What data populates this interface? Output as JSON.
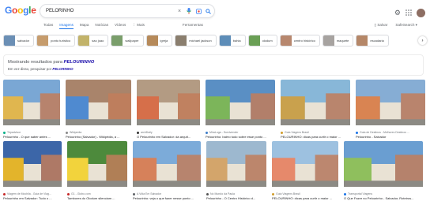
{
  "header": {
    "logo": [
      "G",
      "o",
      "o",
      "g",
      "l",
      "e"
    ],
    "logo_colors": [
      "#4285f4",
      "#ea4335",
      "#fbbc05",
      "#4285f4",
      "#34a853",
      "#ea4335"
    ],
    "query": "PELORINHO"
  },
  "tabs": {
    "items": [
      "Todas",
      "Imagens",
      "Mapa",
      "Notícias",
      "Vídeos",
      "⋮ Mais"
    ],
    "active": "Imagens",
    "tools": "Ferramentas",
    "safe": "Salvar",
    "safesearch": "SafeSearch"
  },
  "chips": [
    {
      "label": "salvador",
      "color": "#6b8fb5"
    },
    {
      "label": "ponto turístico",
      "color": "#c69c6d"
    },
    {
      "label": "sao joao",
      "color": "#c2b36a"
    },
    {
      "label": "wallpaper",
      "color": "#7a9e6b"
    },
    {
      "label": "igreja",
      "color": "#b68a5a"
    },
    {
      "label": "michael jackson",
      "color": "#8a7e6e"
    },
    {
      "label": "bahia",
      "color": "#5d8db8"
    },
    {
      "label": "olodum",
      "color": "#6a9f55"
    },
    {
      "label": "centro histórico",
      "color": "#b7876e"
    },
    {
      "label": "maquete",
      "color": "#a7a3a0"
    },
    {
      "label": "escadaria",
      "color": "#b58768"
    }
  ],
  "results": {
    "showing_prefix": "Mostrando resultados para",
    "showing_term": "PELOURINHO",
    "instead_prefix": "Em vez disso, pesquisar por",
    "instead_term": "PELORINHO"
  },
  "row1": [
    {
      "source": "Tripadvisor",
      "title": "Pelourinho - O que saber antes ...",
      "color": "#7aa7d4",
      "accent": "#e0b64f",
      "dot": "#00af87"
    },
    {
      "source": "Wikipedia",
      "title": "Pelourinho (Salvador) - Wikipédia, a ...",
      "color": "#a9846b",
      "accent": "#4f8ad0",
      "dot": "#888888"
    },
    {
      "source": "archDaily",
      "title": "O Pelourinho em Salvador: da arquit...",
      "color": "#b39b83",
      "accent": "#d66f4a",
      "dot": "#333333"
    },
    {
      "source": "MiraLuga - Survivender",
      "title": "Pelourinho: bairro tudo sobre esse ponto ...",
      "color": "#5a8fc4",
      "accent": "#7cb55a",
      "dot": "#3b7cc9"
    },
    {
      "source": "Guia Viagens Brasil",
      "title": "PELOURINHO: dicas para curtir o maior ...",
      "color": "#88b7d8",
      "accent": "#c9a14d",
      "dot": "#d19d2a"
    },
    {
      "source": "Guia de Destinos - Melhores Destinos ...",
      "title": "Pelourinho - Salvador",
      "color": "#86add4",
      "accent": "#d98452",
      "dot": "#1a73e8"
    }
  ],
  "row2": [
    {
      "source": "Viagem de Mochila - Guia de Viag...",
      "title": "Pelourinho em Salvador: Tudo o ...",
      "color": "#3c66a8",
      "accent": "#e3b42b",
      "dot": "#c62828"
    },
    {
      "source": "G1 - Globo.com",
      "title": "Tambores do Olodum silenciam ...",
      "color": "#4d8a3c",
      "accent": "#f2d33c",
      "dot": "#c62828"
    },
    {
      "source": "A Vida Em Salvador",
      "title": "Pelourinho: veja o que fazer nesse ponto ...",
      "color": "#7cabd9",
      "accent": "#d6815a",
      "dot": "#5f6368"
    },
    {
      "source": "No Mundo da Paula",
      "title": "Pelourinho - O Centro Histórico d...",
      "color": "#9db8cf",
      "accent": "#d3a56b",
      "dot": "#555555"
    },
    {
      "source": "Guia Viagens Brasil",
      "title": "PELOURINHO: dicas para curtir o maior ...",
      "color": "#9dc1e0",
      "accent": "#e6896b",
      "dot": "#d19d2a"
    },
    {
      "source": "Transportal Viagens",
      "title": "O Que Fazer no Pelourinho - Salvador, Roteiros...",
      "color": "#6a9ed1",
      "accent": "#8fbf5d",
      "dot": "#1a73e8"
    }
  ]
}
